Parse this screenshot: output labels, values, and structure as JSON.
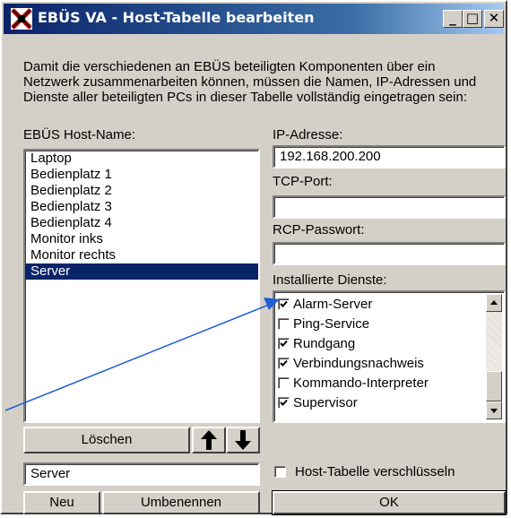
{
  "window": {
    "title": "EBÜS VA - Host-Tabelle bearbeiten",
    "minimize_glyph": "_",
    "maximize_glyph": "□",
    "close_glyph": "✕"
  },
  "intro": {
    "line1": "Damit die verschiedenen an EBÜS beteiligten Komponenten über ein",
    "line2": "Netzwerk zusammenarbeiten können, müssen die Namen, IP-Adressen und",
    "line3": "Dienste aller beteiligten PCs in dieser Tabelle vollständig eingetragen sein:"
  },
  "hosts": {
    "label": "EBÜS Host-Name:",
    "items": [
      "Laptop",
      "Bedienplatz 1",
      "Bedienplatz 2",
      "Bedienplatz 3",
      "Bedienplatz 4",
      "Monitor inks",
      "Monitor rechts",
      "Server"
    ],
    "selected": "Server",
    "delete_label": "Löschen",
    "up_icon": "arrow-up-icon",
    "down_icon": "arrow-down-icon",
    "name_value": "Server",
    "new_label": "Neu",
    "rename_label": "Umbenennen"
  },
  "ip": {
    "label": "IP-Adresse:",
    "value": "192.168.200.200"
  },
  "tcp": {
    "label": "TCP-Port:",
    "value": ""
  },
  "rcp": {
    "label": "RCP-Passwort:",
    "value": ""
  },
  "services": {
    "label": "Installierte Dienste:",
    "items": [
      {
        "name": "Alarm-Server",
        "checked": true
      },
      {
        "name": "Ping-Service",
        "checked": false
      },
      {
        "name": "Rundgang",
        "checked": true
      },
      {
        "name": "Verbindungsnachweis",
        "checked": true
      },
      {
        "name": "Kommando-Interpreter",
        "checked": false
      },
      {
        "name": "Supervisor",
        "checked": true
      }
    ]
  },
  "encrypt": {
    "label": "Host-Tabelle verschlüsseln",
    "checked": false
  },
  "ok_label": "OK",
  "colors": {
    "titlebar_start": "#0a246a",
    "titlebar_end": "#a6caf0",
    "face": "#d4d0c8",
    "selection": "#0a246a",
    "annotation_arrow": "#1f5fd6"
  }
}
